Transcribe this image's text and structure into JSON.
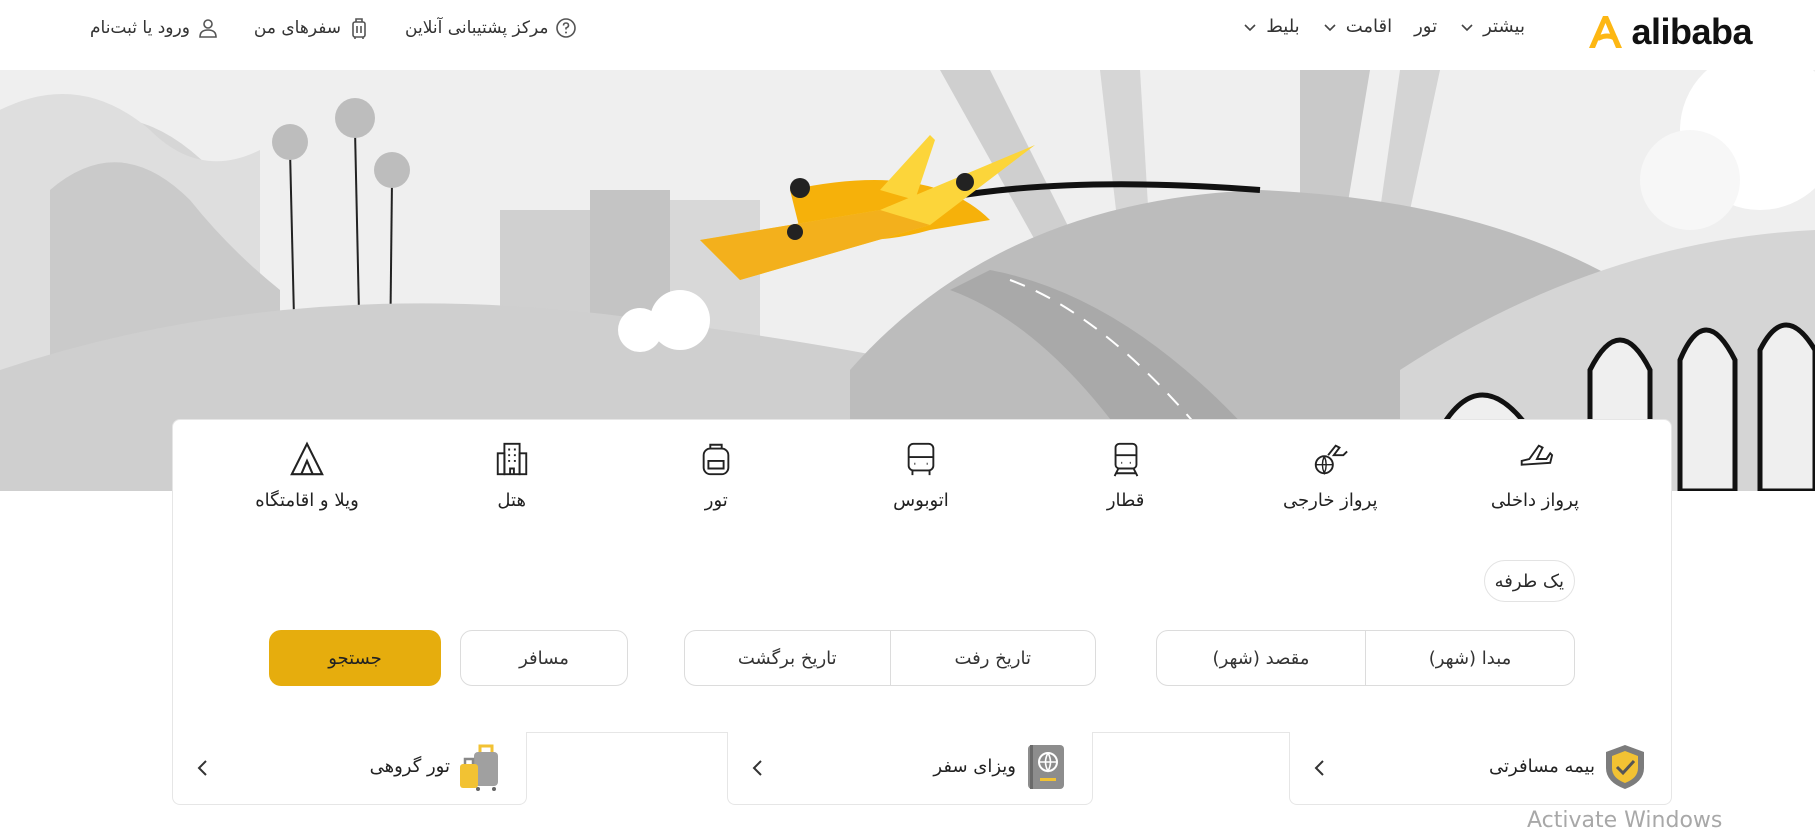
{
  "brand": {
    "name": "alibaba",
    "accent": "#fdb713"
  },
  "nav": {
    "items": [
      {
        "label": "بلیط",
        "icon": "chevron-down-icon"
      },
      {
        "label": "اقامت",
        "icon": "chevron-down-icon"
      },
      {
        "label": "تور",
        "icon": ""
      },
      {
        "label": "بیشتر",
        "icon": "chevron-down-icon"
      }
    ]
  },
  "user_nav": {
    "support": "مرکز پشتیبانی آنلاین",
    "my_trips": "سفرهای من",
    "login": "ورود یا ثبت‌نام"
  },
  "tabs": [
    {
      "label": "پرواز داخلی",
      "icon": "airplane-icon"
    },
    {
      "label": "پرواز خارجی",
      "icon": "international-flight-icon"
    },
    {
      "label": "قطار",
      "icon": "train-icon"
    },
    {
      "label": "اتوبوس",
      "icon": "bus-icon"
    },
    {
      "label": "تور",
      "icon": "backpack-icon"
    },
    {
      "label": "هتل",
      "icon": "hotel-icon"
    },
    {
      "label": "ویلا و اقامتگاه",
      "icon": "villa-icon"
    }
  ],
  "search": {
    "trip_type": "یک طرفه",
    "origin_placeholder": "مبدا (شهر)",
    "destination_placeholder": "مقصد (شهر)",
    "departure_placeholder": "تاریخ رفت",
    "return_placeholder": "تاریخ برگشت",
    "passengers_placeholder": "مسافر",
    "button_label": "جستجو",
    "button_color": "#e6ad0d"
  },
  "promos": [
    {
      "label": "بیمه مسافرتی",
      "icon": "shield-check-icon"
    },
    {
      "label": "ویزای سفر",
      "icon": "passport-icon"
    },
    {
      "label": "تور گروهی",
      "icon": "luggage-icon"
    }
  ],
  "system_watermark": "Activate Windows"
}
